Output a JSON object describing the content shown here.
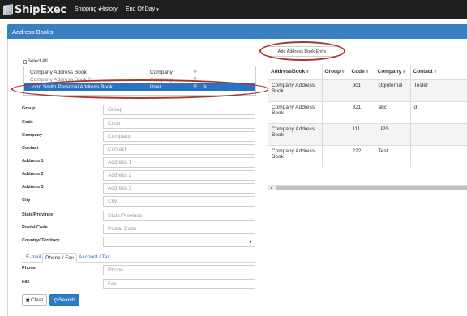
{
  "app": {
    "logo_text": "ShipExec"
  },
  "nav": {
    "items": [
      {
        "label": "Shipping",
        "caret": "▾"
      },
      {
        "label": "History",
        "caret": ""
      },
      {
        "label": "End Of Day",
        "caret": "▾"
      }
    ]
  },
  "panel": {
    "title": "Address Books"
  },
  "address_books": {
    "select_all_label": "Select All",
    "books": [
      {
        "name": "Company Address Book",
        "type": "Company",
        "selected": false
      },
      {
        "name": "Company Address Book 2",
        "type": "Company",
        "selected": false
      },
      {
        "name": "John Smith Personal Address Book",
        "type": "User",
        "selected": true
      }
    ]
  },
  "form": {
    "fields": [
      {
        "label": "Group",
        "placeholder": "Group"
      },
      {
        "label": "Code",
        "placeholder": "Code"
      },
      {
        "label": "Company",
        "placeholder": "Company"
      },
      {
        "label": "Contact",
        "placeholder": "Contact"
      },
      {
        "label": "Address 1",
        "placeholder": "Address 1"
      },
      {
        "label": "Address 2",
        "placeholder": "Address 2"
      },
      {
        "label": "Address 3",
        "placeholder": "Address 3"
      },
      {
        "label": "City",
        "placeholder": "City"
      },
      {
        "label": "State/Province",
        "placeholder": "State/Province"
      },
      {
        "label": "Postal Code",
        "placeholder": "Postal Code"
      }
    ],
    "country_label": "Country/ Territory",
    "country_value": "",
    "tabs": [
      {
        "label": "E-mail",
        "active": false
      },
      {
        "label": "Phone / Fax",
        "active": true
      },
      {
        "label": "Account / Tax",
        "active": false
      }
    ],
    "phone_fields": [
      {
        "label": "Phone",
        "placeholder": "Phone"
      },
      {
        "label": "Fax",
        "placeholder": "Fax"
      }
    ],
    "clear_label": "Clear",
    "search_label": "Search"
  },
  "results": {
    "add_button_label": "Add Address Book Entry",
    "columns": [
      "AddressBook",
      "Group",
      "Code",
      "Company",
      "Contact"
    ],
    "sort_glyph": "⬍",
    "rows": [
      {
        "address_book": "Company Address Book",
        "group": "",
        "code": "pc1",
        "company": "ctginternal",
        "contact": "Tester"
      },
      {
        "address_book": "Company Address Book",
        "group": "",
        "code": "321",
        "company": "abc",
        "contact": "d"
      },
      {
        "address_book": "Company Address Book",
        "group": "",
        "code": "111",
        "company": "UPS",
        "contact": ""
      },
      {
        "address_book": "Company Address Book",
        "group": "",
        "code": "222",
        "company": "Test",
        "contact": ""
      }
    ]
  },
  "colors": {
    "navbar": "#1f1f1f",
    "panel_header": "#3a80c0",
    "selection": "#2b72c2",
    "primary_button": "#2f7dc8",
    "annotation": "#a33a2c"
  },
  "icons": {
    "edit_book": "pencil-square-icon",
    "book_owner": "org-icon",
    "clear": "x-icon",
    "search": "search-icon"
  }
}
